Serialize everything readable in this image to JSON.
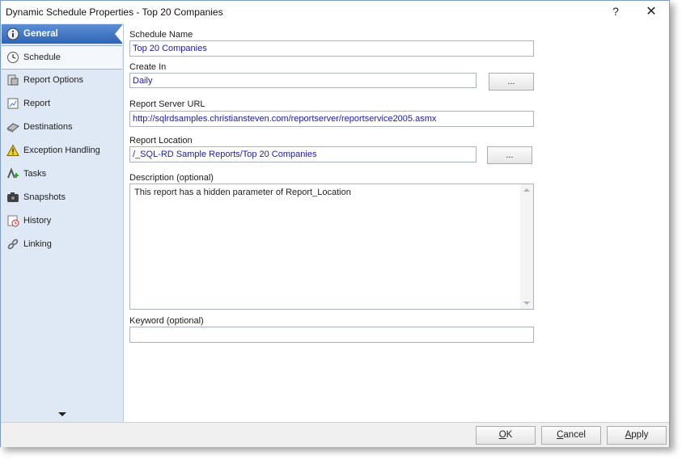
{
  "window": {
    "title": "Dynamic Schedule Properties - Top 20 Companies",
    "help_glyph": "?",
    "close_glyph": "✕"
  },
  "sidebar": {
    "items": [
      {
        "label": "General",
        "icon": "info-icon"
      },
      {
        "label": "Schedule",
        "icon": "clock-icon"
      },
      {
        "label": "Report Options",
        "icon": "report-options-icon"
      },
      {
        "label": "Report",
        "icon": "report-icon"
      },
      {
        "label": "Destinations",
        "icon": "destinations-icon"
      },
      {
        "label": "Exception Handling",
        "icon": "warning-icon"
      },
      {
        "label": "Tasks",
        "icon": "tasks-icon"
      },
      {
        "label": "Snapshots",
        "icon": "camera-icon"
      },
      {
        "label": "History",
        "icon": "history-icon"
      },
      {
        "label": "Linking",
        "icon": "link-icon"
      }
    ],
    "active_color": "#2e64b6"
  },
  "form": {
    "schedule_name": {
      "label": "Schedule Name",
      "value": "Top 20 Companies"
    },
    "create_in": {
      "label": "Create In",
      "value": "Daily",
      "browse": "..."
    },
    "report_server_url": {
      "label": "Report Server URL",
      "value": "http://sqlrdsamples.christiansteven.com/reportserver/reportservice2005.asmx"
    },
    "report_location": {
      "label": "Report Location",
      "value": "/_SQL-RD Sample Reports/Top 20 Companies",
      "browse": "..."
    },
    "description": {
      "label": "Description (optional)",
      "value": "This report has a hidden parameter of Report_Location"
    },
    "keyword": {
      "label": "Keyword (optional)",
      "value": ""
    }
  },
  "footer": {
    "ok_first": "O",
    "ok_rest": "K",
    "cancel_first": "C",
    "cancel_rest": "ancel",
    "apply_first": "A",
    "apply_rest": "pply"
  }
}
